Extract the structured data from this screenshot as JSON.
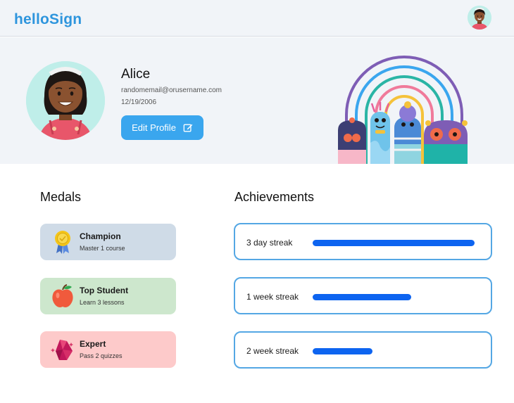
{
  "app": {
    "name": "helloSign"
  },
  "profile": {
    "name": "Alice",
    "email": "randomemail@orusername.com",
    "dob": "12/19/2006",
    "edit_label": "Edit Profile"
  },
  "medals": {
    "title": "Medals",
    "items": [
      {
        "title": "Champion",
        "desc": "Master 1 course",
        "icon": "ribbon-medal-icon",
        "color": "#cfdbe7"
      },
      {
        "title": "Top Student",
        "desc": "Learn 3 lessons",
        "icon": "apple-icon",
        "color": "#cde7cd"
      },
      {
        "title": "Expert",
        "desc": "Pass 2 quizzes",
        "icon": "gem-icon",
        "color": "#fdcaca"
      }
    ]
  },
  "achievements": {
    "title": "Achievements",
    "items": [
      {
        "label": "3 day streak",
        "progress": 1.0
      },
      {
        "label": "1 week streak",
        "progress": 0.61
      },
      {
        "label": "2 week streak",
        "progress": 0.37
      }
    ]
  },
  "colors": {
    "brand": "#2e95dd",
    "button": "#3aa6ee",
    "progress": "#0d64f0",
    "card_border": "#54a7e4"
  }
}
